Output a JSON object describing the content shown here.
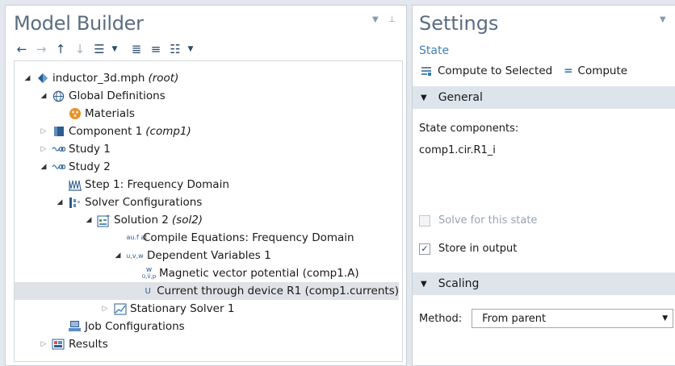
{
  "model_builder": {
    "title": "Model Builder",
    "tree": [
      {
        "label": "inductor_3d.mph",
        "suffix": "(root)"
      },
      {
        "label": "Global Definitions",
        "suffix": ""
      },
      {
        "label": "Materials",
        "suffix": ""
      },
      {
        "label": "Component 1",
        "suffix": "(comp1)"
      },
      {
        "label": "Study 1",
        "suffix": ""
      },
      {
        "label": "Study 2",
        "suffix": ""
      },
      {
        "label": "Step 1: Frequency Domain",
        "suffix": ""
      },
      {
        "label": "Solver Configurations",
        "suffix": ""
      },
      {
        "label": "Solution 2",
        "suffix": "(sol2)"
      },
      {
        "label": "Compile Equations: Frequency Domain",
        "suffix": ""
      },
      {
        "label": "Dependent Variables 1",
        "suffix": ""
      },
      {
        "label": "Magnetic vector potential (comp1.A)",
        "suffix": ""
      },
      {
        "label": "Current through device R1 (comp1.currents)",
        "suffix": ""
      },
      {
        "label": "Stationary Solver 1",
        "suffix": ""
      },
      {
        "label": "Job Configurations",
        "suffix": ""
      },
      {
        "label": "Results",
        "suffix": ""
      }
    ],
    "icon_texts": {
      "compile": "au.f at",
      "dep": "u,v,w",
      "magpot": "w",
      "current": "U"
    }
  },
  "settings": {
    "title": "Settings",
    "subtitle": "State",
    "compute_selected": "Compute to Selected",
    "compute": "Compute",
    "general_label": "General",
    "state_components_label": "State components:",
    "state_components_value": "comp1.cir.R1_i",
    "solve_label": "Solve for this state",
    "store_label": "Store in output",
    "scaling_label": "Scaling",
    "method_label": "Method:",
    "method_value": "From parent"
  },
  "colors": {
    "accent": "#3f7fbf",
    "title": "#5a6d82",
    "section": "#dde4ec",
    "selection": "#dfe2e6"
  }
}
